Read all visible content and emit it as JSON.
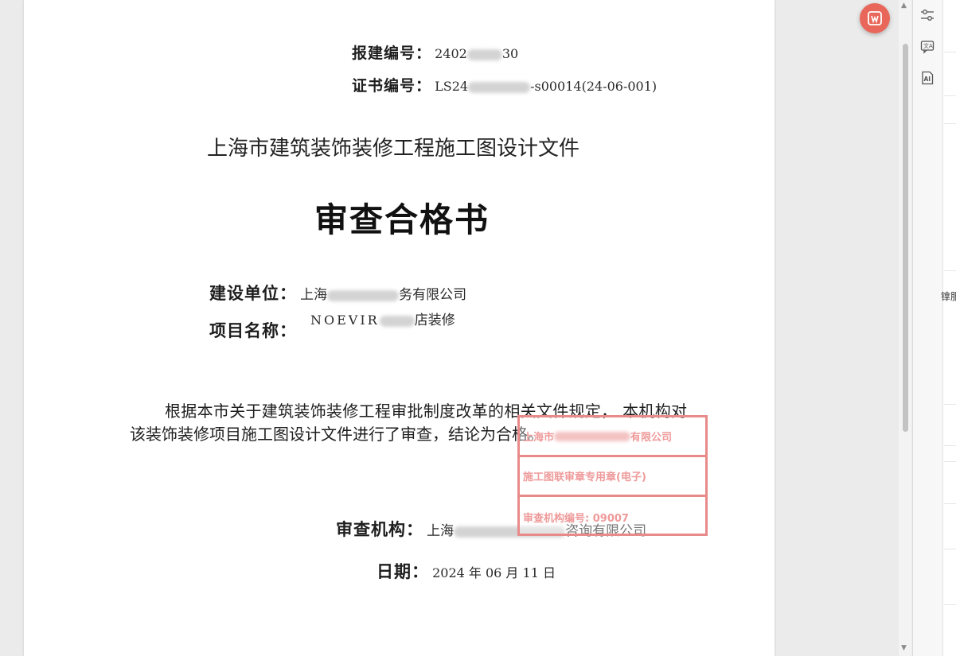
{
  "document": {
    "permit_label": "报建编号",
    "colon": "：",
    "permit_value_visible_start": "2402",
    "permit_value_visible_end": "30",
    "cert_label": "证书编号",
    "cert_value_visible_start": "LS24",
    "cert_value_visible_end": "-s00014(24-06-001)",
    "subtitle": "上海市建筑装饰装修工程施工图设计文件",
    "title": "审查合格书",
    "builder_label": "建设单位",
    "builder_value_start": "上海",
    "builder_value_end": "务有限公司",
    "project_label": "项目名称",
    "project_value_start": "NOEVIR",
    "project_value_end": "店装修",
    "body_text": "根据本市关于建筑装饰装修工程审批制度改革的相关文件规定， 本机构对该装饰装修项目施工图设计文件进行了审查，结论为合格。",
    "agency_label": "审查机构",
    "agency_value_start": "上海",
    "agency_value_end": "咨询有限公司",
    "date_label": "日期",
    "date_value": "2024 年 06 月 11 日"
  },
  "stamp": {
    "row1": "上海市",
    "row1_end": "有限公司",
    "row2": "施工图联审章专用章(电子)",
    "row3": "审查机构编号: 09007"
  },
  "side_panel": {
    "icons": [
      "settings-sliders-icon",
      "translate-chat-icon",
      "ai-icon"
    ],
    "edge_text": "镎服"
  },
  "colors": {
    "stamp_red": "#e98a8a",
    "fab_red": "#e8675a"
  }
}
